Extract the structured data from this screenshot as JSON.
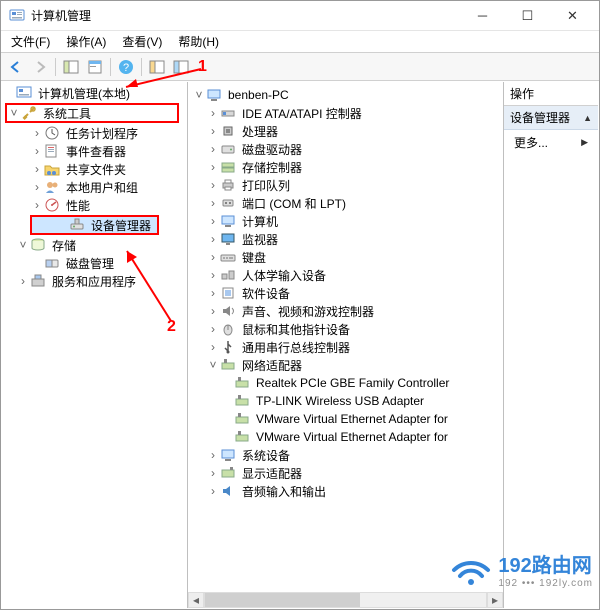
{
  "window": {
    "title": "计算机管理"
  },
  "menu": {
    "file": "文件(F)",
    "action": "操作(A)",
    "view": "查看(V)",
    "help": "帮助(H)"
  },
  "annot": {
    "one": "1",
    "two": "2"
  },
  "left_tree": {
    "root": "计算机管理(本地)",
    "system_tools": "系统工具",
    "task_scheduler": "任务计划程序",
    "event_viewer": "事件查看器",
    "shared_folders": "共享文件夹",
    "local_users": "本地用户和组",
    "performance": "性能",
    "device_manager": "设备管理器",
    "storage": "存储",
    "disk_mgmt": "磁盘管理",
    "services_apps": "服务和应用程序"
  },
  "device_tree": {
    "root": "benben-PC",
    "ide": "IDE ATA/ATAPI 控制器",
    "cpu": "处理器",
    "disk": "磁盘驱动器",
    "storage_ctrl": "存储控制器",
    "print_queue": "打印队列",
    "ports": "端口 (COM 和 LPT)",
    "computer": "计算机",
    "monitor": "监视器",
    "keyboard": "键盘",
    "hid": "人体学输入设备",
    "software": "软件设备",
    "sound": "声音、视频和游戏控制器",
    "mouse": "鼠标和其他指针设备",
    "usb": "通用串行总线控制器",
    "net": "网络适配器",
    "net_items": {
      "realtek": "Realtek PCIe GBE Family Controller",
      "tplink": "TP-LINK Wireless USB Adapter",
      "vmnet1": "VMware Virtual Ethernet Adapter for",
      "vmnet2": "VMware Virtual Ethernet Adapter for"
    },
    "system_dev": "系统设备",
    "display": "显示适配器",
    "audio_io": "音频输入和输出"
  },
  "actions": {
    "header": "操作",
    "section": "设备管理器",
    "more": "更多..."
  },
  "watermark": {
    "main": "192路由网",
    "sub": "192 ••• 192ly.com"
  }
}
